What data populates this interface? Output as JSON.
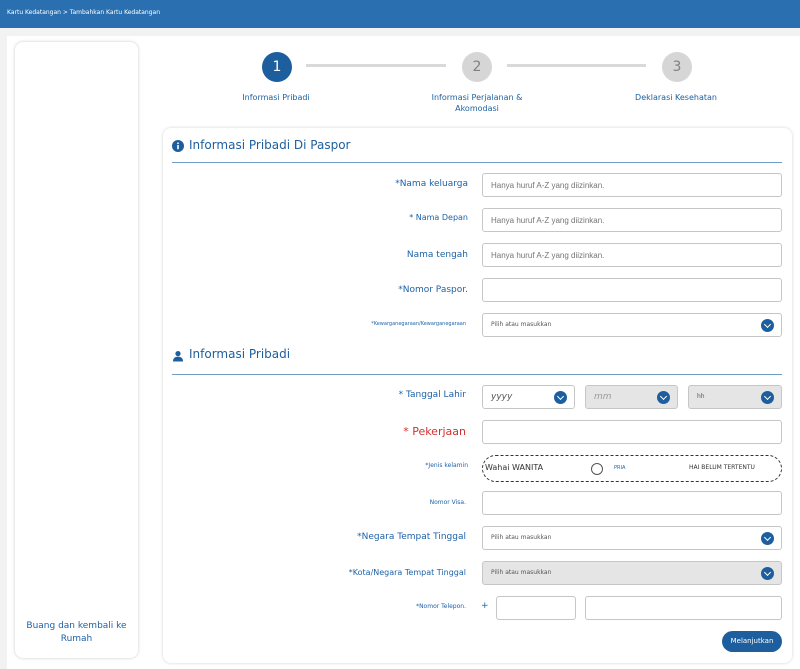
{
  "header": {
    "breadcrumb": "Kartu Kedatangan > Tambahkan Kartu Kedatangan"
  },
  "sidebar": {
    "back_link": "Buang dan kembali ke Rumah"
  },
  "stepper": {
    "steps": [
      {
        "number": "1",
        "label": "Informasi Pribadi",
        "state": "active"
      },
      {
        "number": "2",
        "label": "Informasi Perjalanan & Akomodasi",
        "state": "inactive"
      },
      {
        "number": "3",
        "label": "Deklarasi Kesehatan",
        "state": "inactive"
      }
    ]
  },
  "section_passport": {
    "title": "Informasi Pribadi Di Paspor",
    "icon": "info-icon",
    "fields": {
      "family_name": {
        "label": "*Nama keluarga",
        "placeholder": "Hanya huruf A-Z yang diizinkan."
      },
      "first_name": {
        "label": "* Nama Depan",
        "placeholder": "Hanya huruf A-Z yang diizinkan."
      },
      "middle_name": {
        "label": "Nama tengah",
        "placeholder": "Hanya huruf A-Z yang diizinkan."
      },
      "passport_no": {
        "label": "*Nomor Paspor.",
        "value": ""
      },
      "nationality": {
        "label": "*Kewarganegaraan/Kewarganegaraan",
        "placeholder": "Pilih atau masukkan"
      }
    }
  },
  "section_personal": {
    "title": "Informasi Pribadi",
    "icon": "person-icon",
    "fields": {
      "dob": {
        "label": "* Tanggal Lahir",
        "year": "yyyy",
        "month": "mm",
        "day": "hh"
      },
      "occupation": {
        "label": "* Pekerjaan",
        "value": ""
      },
      "gender": {
        "label": "*Jenis kelamin",
        "options": [
          "Wahai WANITA",
          "PRIA",
          "HAI BELUM TERTENTU"
        ]
      },
      "visa": {
        "label": "Nomor Visa.",
        "value": ""
      },
      "country": {
        "label": "*Negara Tempat Tinggal",
        "placeholder": "Pilih atau masukkan"
      },
      "city": {
        "label": "*Kota/Negara Tempat Tinggal",
        "placeholder": "Pilih atau masukkan"
      },
      "phone": {
        "label": "*Nomor Telepon.",
        "prefix": "+",
        "code": "",
        "number": ""
      }
    }
  },
  "actions": {
    "continue": "Melanjutkan"
  },
  "colors": {
    "primary": "#1d5f9e",
    "header": "#2a70b0",
    "required_red": "#d32f2f",
    "disabled_bg": "#e5e5e5"
  }
}
